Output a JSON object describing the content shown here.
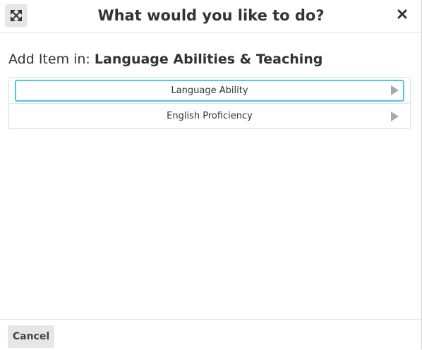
{
  "dialog": {
    "title": "What would you like to do?",
    "expand_icon": "expand-arrows-icon",
    "close_icon": "close-x-icon",
    "context_prefix": "Add Item in: ",
    "context_target": "Language Abilities & Teaching",
    "items": [
      {
        "label": "Language Ability",
        "icon": "chevron-right-icon",
        "focused": true
      },
      {
        "label": "English Proficiency",
        "icon": "chevron-right-icon",
        "focused": false
      }
    ],
    "cancel_label": "Cancel"
  },
  "colors": {
    "focus_ring": "#4fc8e0",
    "button_bg": "#e6e6e6",
    "text": "#333333",
    "arrow": "#a9a9a9"
  }
}
